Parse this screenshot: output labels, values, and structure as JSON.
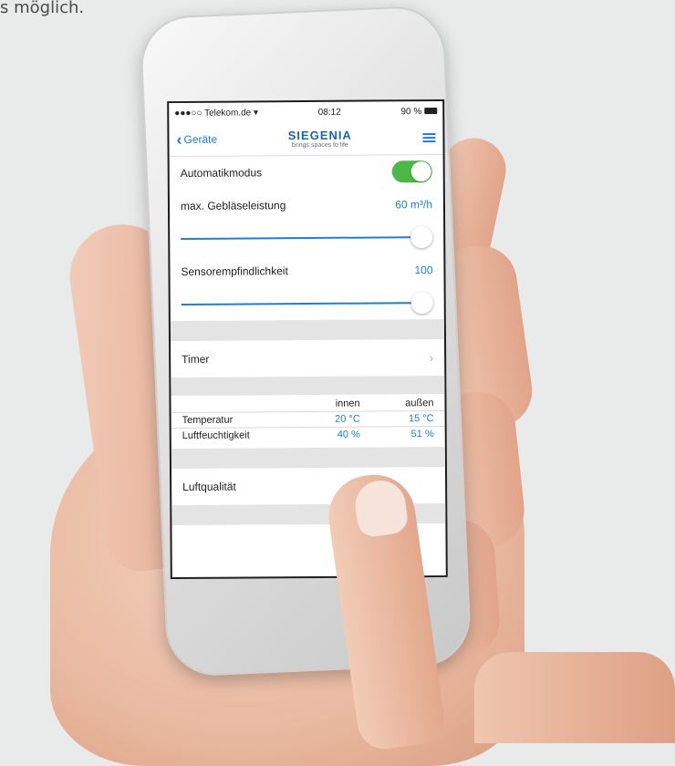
{
  "caption": "s möglich.",
  "status_bar": {
    "carrier": "●●●○○ Telekom.de",
    "wifi": "wifi-icon",
    "time": "08:12",
    "battery": "90 %"
  },
  "nav": {
    "back_label": "Geräte",
    "brand": "SIEGENIA",
    "tagline": "brings spaces to life",
    "menu_icon": "hamburger-menu-icon"
  },
  "settings": {
    "auto_mode": {
      "label": "Automatikmodus",
      "on": true
    },
    "max_fan": {
      "label": "max. Gebläseleistung",
      "value": "60 m³/h",
      "slider_level": 1.0
    },
    "sensor": {
      "label": "Sensorempfindlichkeit",
      "value": "100",
      "slider_level": 1.0
    }
  },
  "timer": {
    "label": "Timer",
    "arrow": "chevron-right-icon"
  },
  "climate": {
    "col_inside": "innen",
    "col_outside": "außen",
    "rows": [
      {
        "label": "Temperatur",
        "inside": "20 °C",
        "outside": "15 °C"
      },
      {
        "label": "Luftfeuchtigkeit",
        "inside": "40 %",
        "outside": "51 %"
      }
    ]
  },
  "air_quality": {
    "label": "Luftqualität"
  },
  "colors": {
    "accent": "#1f7fd1",
    "toggle_on": "#4cb848",
    "brand": "#1a64b0"
  }
}
